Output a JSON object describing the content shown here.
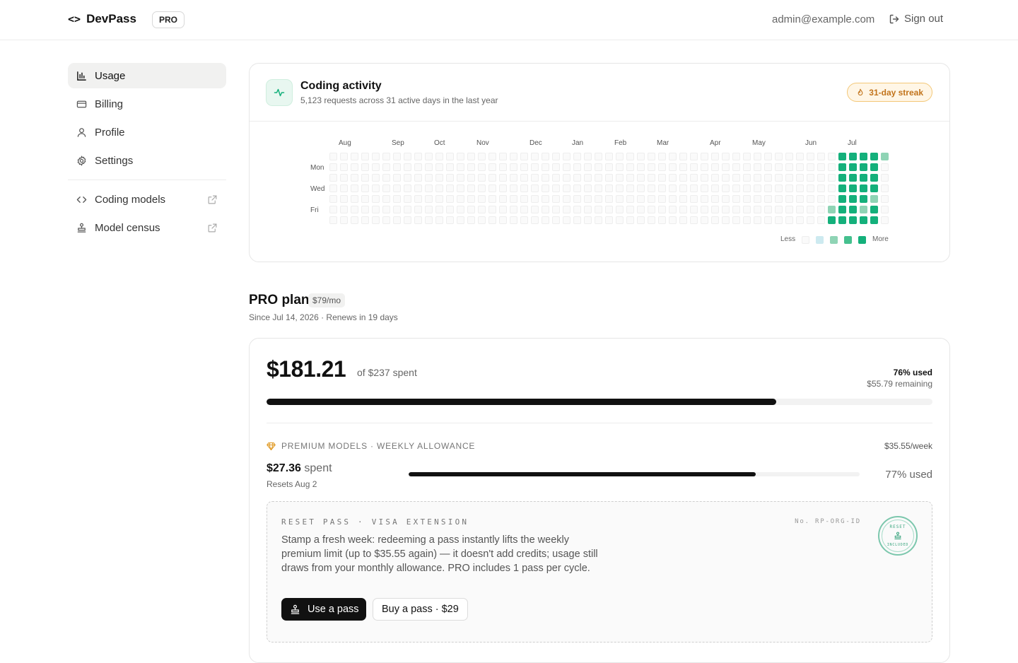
{
  "header": {
    "brand_icon": "<>",
    "brand_name": "DevPass",
    "plan_badge": "PRO",
    "user_email": "admin@example.com",
    "signout_label": "Sign out"
  },
  "sidebar": {
    "items": [
      {
        "label": "Usage",
        "icon": "bar-chart-icon",
        "active": true
      },
      {
        "label": "Billing",
        "icon": "credit-card-icon"
      },
      {
        "label": "Profile",
        "icon": "user-icon"
      },
      {
        "label": "Settings",
        "icon": "gear-icon"
      }
    ],
    "external_items": [
      {
        "label": "Coding models",
        "icon": "code-icon"
      },
      {
        "label": "Model census",
        "icon": "stamp-icon"
      }
    ]
  },
  "activity": {
    "title": "Coding activity",
    "subtitle": "5,123 requests across 31 active days in the last year",
    "streak": "31-day streak",
    "months": [
      "Aug",
      "Sep",
      "Oct",
      "Nov",
      "Dec",
      "Jan",
      "Feb",
      "Mar",
      "Apr",
      "May",
      "Jun",
      "Jul"
    ],
    "days": [
      "Mon",
      "Wed",
      "Fri"
    ],
    "legend_less": "Less",
    "legend_more": "More",
    "colors": {
      "level0": "#fafafa",
      "level1": "#cdeaf0",
      "level2": "#8fd4b5",
      "level3": "#45c08e",
      "level4": "#14b07b"
    }
  },
  "plan": {
    "title": "PRO plan",
    "price": "$79/mo",
    "subtitle": "Since Jul 14, 2026 · Renews in 19 days"
  },
  "usage": {
    "spent": "$181.21",
    "of_label": "of $237 spent",
    "used_pct_label": "76% used",
    "remaining_label": "$55.79 remaining",
    "progress": 0.765
  },
  "premium": {
    "label": "PREMIUM MODELS · WEEKLY ALLOWANCE",
    "rate": "$35.55/week",
    "spent_amount": "$27.36",
    "spent_word": "spent",
    "reset": "Resets Aug 2",
    "used_label": "77% used",
    "progress": 0.77
  },
  "reset_pass": {
    "kicker": "RESET PASS · VISA EXTENSION",
    "number": "No. RP-ORG-ID",
    "description": "Stamp a fresh week: redeeming a pass instantly lifts the weekly premium limit (up to $35.55 again) — it doesn't add credits; usage still draws from your monthly allowance. PRO includes 1 pass per cycle.",
    "stamp_top": "RESET",
    "stamp_bottom": "INCLUDED",
    "use_button": "Use a pass",
    "buy_button": "Buy a pass · $29"
  }
}
